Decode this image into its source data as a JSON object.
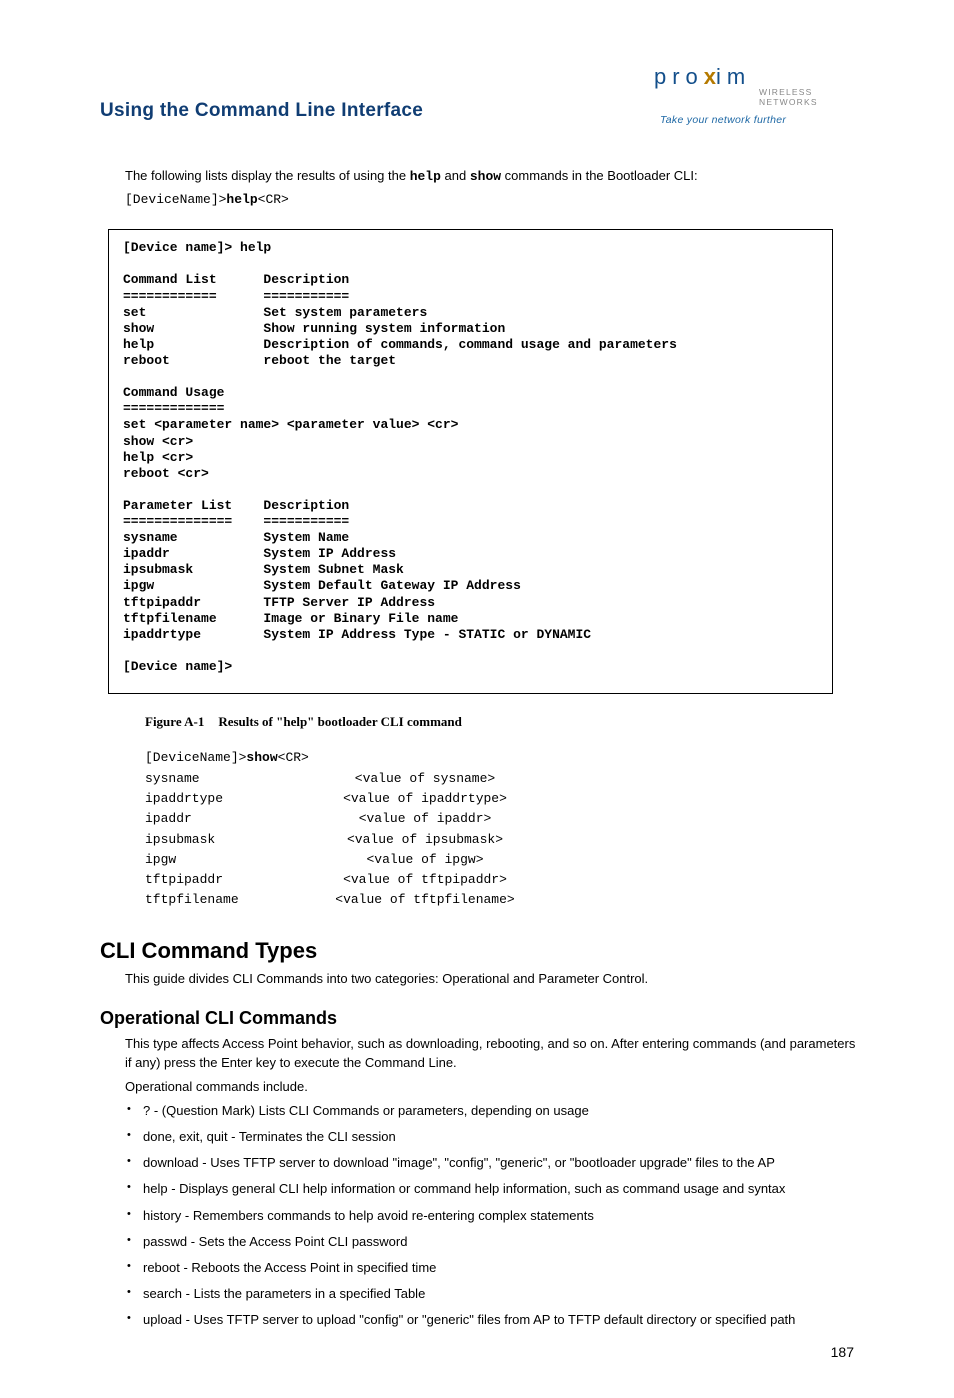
{
  "logo": {
    "name_pre": "pro",
    "name_x": "x",
    "name_post": "im",
    "line2": "WIRELESS NETWORKS",
    "tagline": "Take your network further"
  },
  "chapter_title": "Using the Command Line Interface",
  "intro": {
    "pre": "The following lists display the results of using the ",
    "cmd1": "help",
    "mid": " and ",
    "cmd2": "show",
    "post": " commands in the Bootloader CLI:"
  },
  "help_prompt": {
    "dev": "[DeviceName]>",
    "cmd": "help",
    "cr": "<CR>"
  },
  "help_output": "[Device name]> help\n\nCommand List      Description\n============      ===========\nset               Set system parameters\nshow              Show running system information\nhelp              Description of commands, command usage and parameters\nreboot            reboot the target\n\nCommand Usage\n=============\nset <parameter name> <parameter value> <cr>\nshow <cr>\nhelp <cr>\nreboot <cr>\n\nParameter List    Description\n==============    ===========\nsysname           System Name\nipaddr            System IP Address\nipsubmask         System Subnet Mask\nipgw              System Default Gateway IP Address\ntftpipaddr        TFTP Server IP Address\ntftpfilename      Image or Binary File name\nipaddrtype        System IP Address Type - STATIC or DYNAMIC\n\n[Device name]>",
  "figure": {
    "num": "Figure A-1",
    "title": "Results of \"help\" bootloader CLI command"
  },
  "show_prompt": {
    "dev": "[DeviceName]>",
    "cmd": "show",
    "cr": "<CR>"
  },
  "show_rows": [
    {
      "k": "sysname",
      "v": "<value of sysname>"
    },
    {
      "k": "ipaddrtype",
      "v": "<value of ipaddrtype>"
    },
    {
      "k": "ipaddr",
      "v": "<value of ipaddr>"
    },
    {
      "k": "ipsubmask",
      "v": "<value of ipsubmask>"
    },
    {
      "k": "ipgw",
      "v": "<value of ipgw>"
    },
    {
      "k": "tftpipaddr",
      "v": "<value of tftpipaddr>"
    },
    {
      "k": "tftpfilename",
      "v": "<value of tftpfilename>"
    }
  ],
  "section2_title": "CLI Command Types",
  "section2_body": "This guide divides CLI Commands into two categories: Operational and Parameter Control.",
  "subsection_title": "Operational CLI Commands",
  "subsection_p1": "This type affects Access Point behavior, such as downloading, rebooting, and so on. After entering commands (and parameters if any) press the Enter key to execute the Command Line.",
  "subsection_p2": "Operational commands include.",
  "commands": [
    "? - (Question Mark) Lists CLI Commands or parameters, depending on usage",
    "done, exit, quit - Terminates the CLI session",
    "download - Uses TFTP server to download \"image\", \"config\", \"generic\", or \"bootloader upgrade\" files to the AP",
    "help - Displays general CLI help information or command help information, such as command usage and syntax",
    "history - Remembers commands to help avoid re-entering complex statements",
    "passwd - Sets the Access Point CLI password",
    "reboot - Reboots the Access Point in specified time",
    "search - Lists the parameters in a specified Table",
    "upload - Uses TFTP server to upload \"config\" or \"generic\" files from AP to TFTP default directory or specified path"
  ],
  "page_number": "187"
}
